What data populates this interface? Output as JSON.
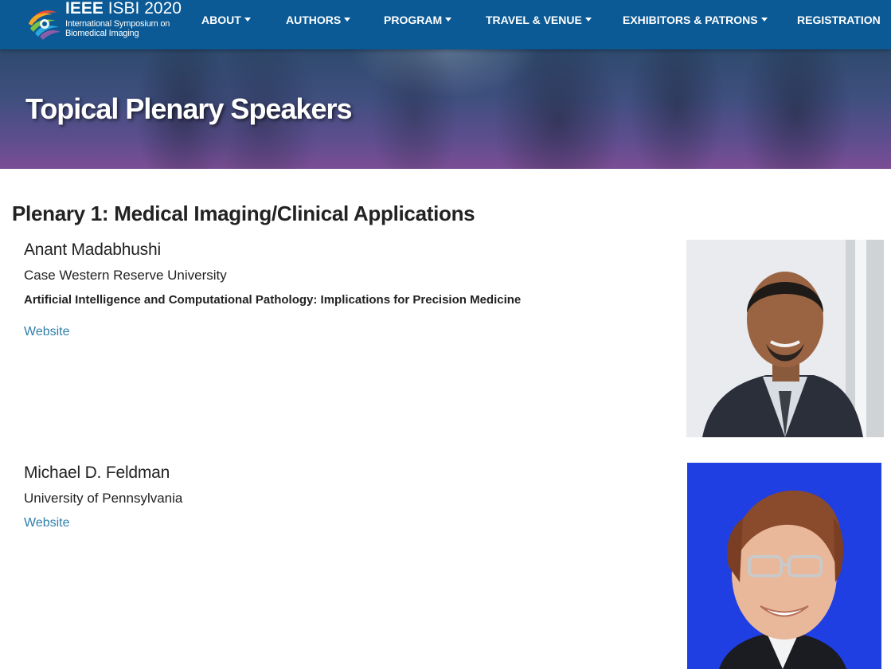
{
  "logo": {
    "line1_bold": "IEEE",
    "line1_rest": "ISBI 2020",
    "line2": "International Symposium on",
    "line3": "Biomedical Imaging"
  },
  "nav": {
    "items": [
      {
        "label": "ABOUT",
        "dropdown": true
      },
      {
        "label": "AUTHORS",
        "dropdown": true
      },
      {
        "label": "PROGRAM",
        "dropdown": true
      },
      {
        "label": "TRAVEL & VENUE",
        "dropdown": true
      },
      {
        "label": "EXHIBITORS & PATRONS",
        "dropdown": true
      },
      {
        "label": "REGISTRATION",
        "dropdown": false
      }
    ]
  },
  "hero": {
    "title": "Topical Plenary Speakers"
  },
  "section": {
    "heading": "Plenary 1: Medical Imaging/Clinical Applications"
  },
  "speakers": [
    {
      "name": "Anant Madabhushi",
      "affiliation": "Case Western Reserve University",
      "talk": "Artificial Intelligence and Computational Pathology: Implications for Precision Medicine",
      "link": "Website"
    },
    {
      "name": "Michael D. Feldman",
      "affiliation": "University of Pennsylvania",
      "link": "Website"
    }
  ],
  "colors": {
    "navbar": "#0b5a95",
    "link": "#2f7fab",
    "text": "#222222"
  }
}
